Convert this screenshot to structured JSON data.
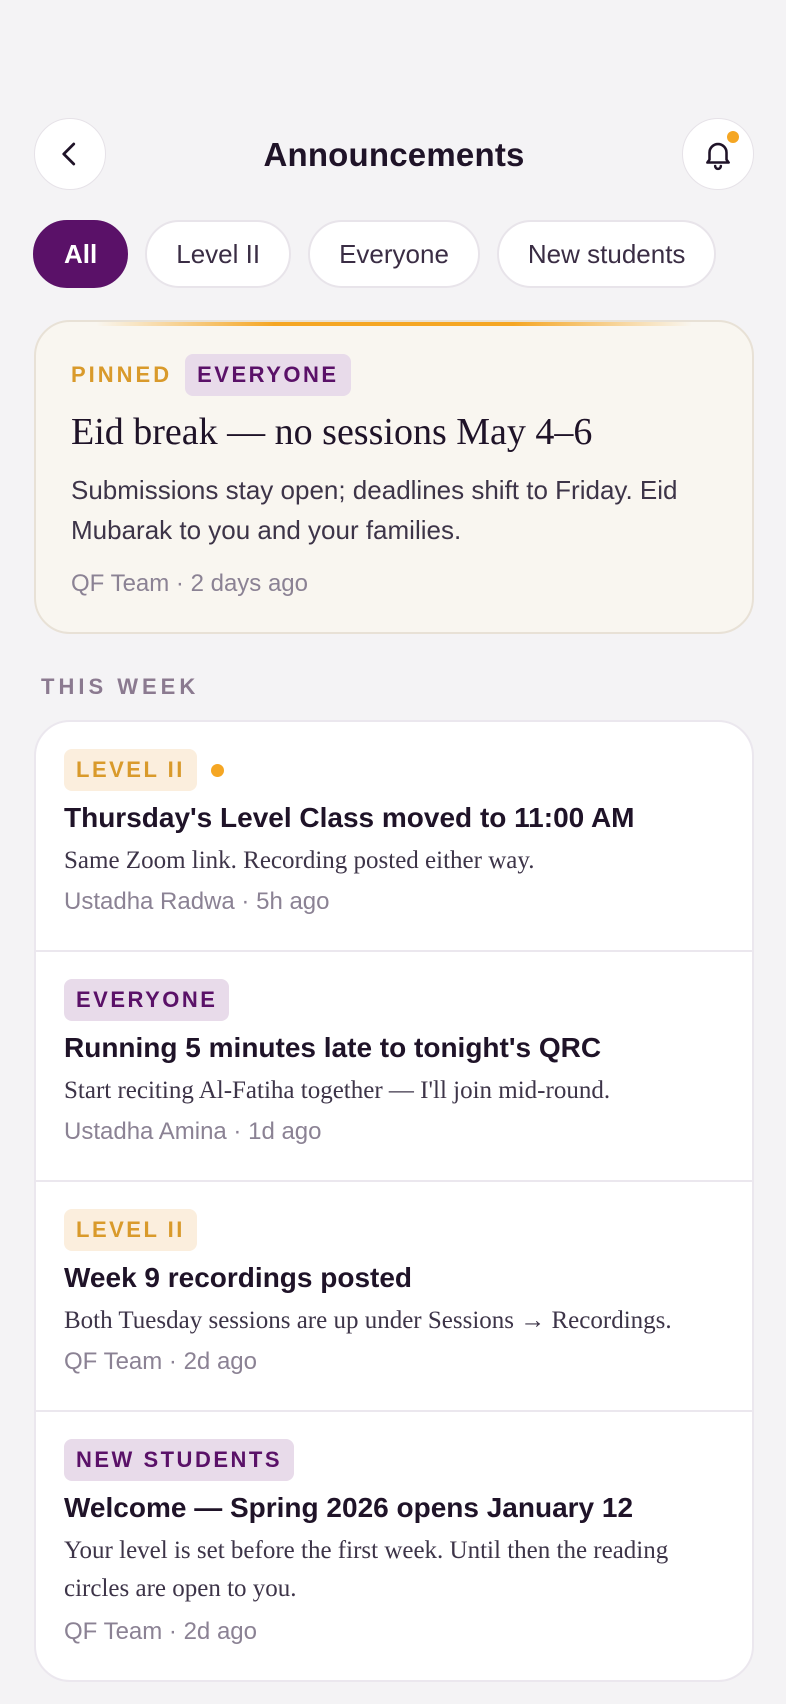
{
  "header": {
    "back_icon": "chevron-left-icon",
    "title": "Announcements",
    "bell_icon": "bell-icon",
    "has_unread": true
  },
  "filters": [
    {
      "label": "All",
      "active": true
    },
    {
      "label": "Level II",
      "active": false
    },
    {
      "label": "Everyone",
      "active": false
    },
    {
      "label": "New students",
      "active": false
    }
  ],
  "pinned": {
    "pinned_label": "PINNED",
    "audience": "EVERYONE",
    "title": "Eid break — no sessions May 4–6",
    "body": "Submissions stay open; deadlines shift to Friday. Eid Mubarak to you and your families.",
    "meta": "QF Team · 2 days ago"
  },
  "section": {
    "label": "THIS WEEK"
  },
  "announcements": [
    {
      "audience": "LEVEL II",
      "unread": true,
      "title": "Thursday's Level Class moved to 11:00 AM",
      "body": "Same Zoom link. Recording posted either way.",
      "meta": "Ustadha Radwa · 5h ago"
    },
    {
      "audience": "EVERYONE",
      "unread": false,
      "title": "Running 5 minutes late to tonight's QRC",
      "body": "Start reciting Al-Fatiha together — I'll join mid-round.",
      "meta": "Ustadha Amina · 1d ago"
    },
    {
      "audience": "LEVEL II",
      "unread": false,
      "title": "Week 9 recordings posted",
      "body": "Both Tuesday sessions are up under Sessions → Recordings.",
      "meta": "QF Team · 2d ago"
    },
    {
      "audience": "NEW STUDENTS",
      "unread": false,
      "title": "Welcome — Spring 2026 opens January 12",
      "body": "Your level is set before the first week. Until then the reading circles are open to you.",
      "meta": "QF Team · 2d ago"
    }
  ],
  "colors": {
    "accent_purple": "#5a1168",
    "accent_gold": "#f5a623",
    "background": "#f4f3f5"
  }
}
